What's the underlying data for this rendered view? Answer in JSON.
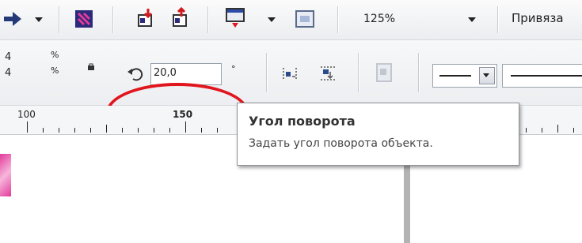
{
  "toolbar_top": {
    "zoom_value": "125%",
    "snap_label": "Привяза"
  },
  "toolbar_props": {
    "width_value": "4",
    "height_value": "4",
    "percent_top": "%",
    "percent_bottom": "%",
    "rotation_value": "20,0",
    "rotation_unit": "°"
  },
  "ruler": {
    "labels": [
      "100",
      "150"
    ]
  },
  "tooltip": {
    "title": "Угол поворота",
    "description": "Задать угол поворота объекта."
  },
  "colors": {
    "callout": "#e0161e",
    "accent_pink": "#e23a9a"
  }
}
